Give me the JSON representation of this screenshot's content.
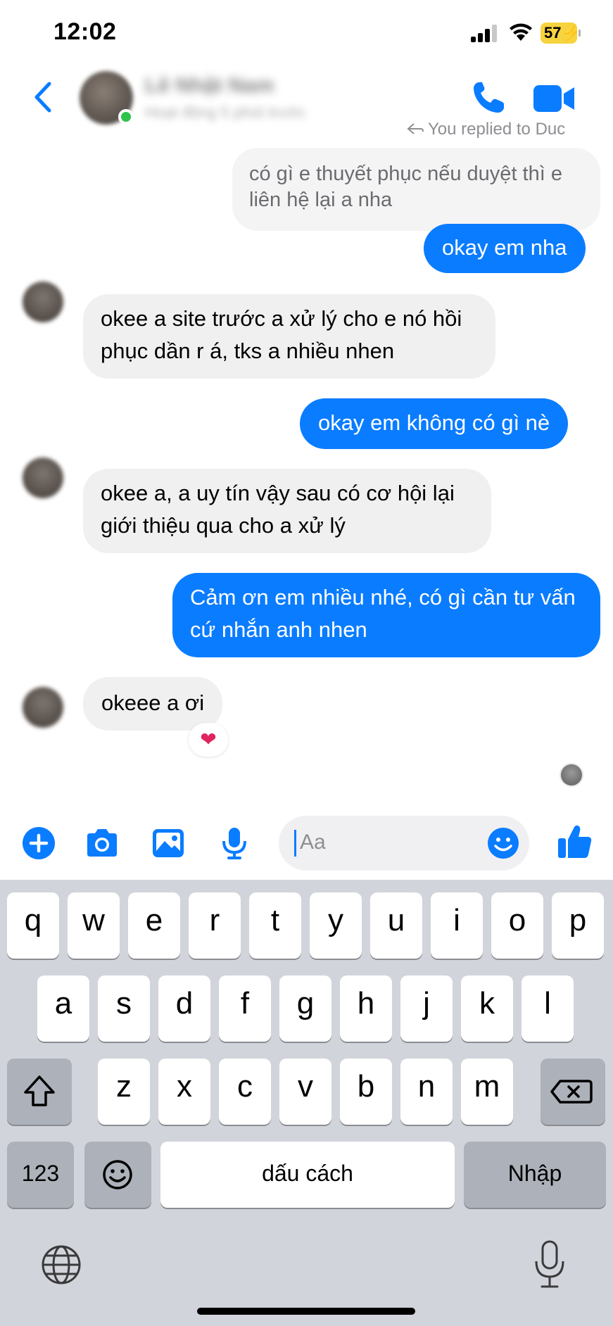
{
  "status_bar": {
    "time": "12:02",
    "battery": "57"
  },
  "header": {
    "name": "Lê Nhật Nam",
    "status": "Hoạt động 5 phút trước"
  },
  "chat": {
    "replied_note": "You replied to Duc",
    "messages": [
      {
        "direction": "outgoing_quote",
        "text": "có gì e thuyết phục nếu duyệt thì e liên hệ lại a nha"
      },
      {
        "direction": "outgoing",
        "text": "okay em nha"
      },
      {
        "direction": "incoming",
        "text": "okee a site trước a xử lý cho e nó hồi phục dần r á, tks a nhiều nhen"
      },
      {
        "direction": "outgoing",
        "text": "okay em không có gì nè"
      },
      {
        "direction": "incoming",
        "text": "okee a, a uy tín vậy sau có cơ hội lại giới thiệu qua cho a xử lý"
      },
      {
        "direction": "outgoing",
        "text": "Cảm ơn em nhiều nhé, có gì cần tư vấn cứ nhắn anh nhen"
      },
      {
        "direction": "incoming",
        "text": "okeee a ơi",
        "reaction": "❤"
      }
    ]
  },
  "composer": {
    "placeholder": "Aa"
  },
  "keyboard": {
    "row1": [
      "q",
      "w",
      "e",
      "r",
      "t",
      "y",
      "u",
      "i",
      "o",
      "p"
    ],
    "row2": [
      "a",
      "s",
      "d",
      "f",
      "g",
      "h",
      "j",
      "k",
      "l"
    ],
    "row3": [
      "z",
      "x",
      "c",
      "v",
      "b",
      "n",
      "m"
    ],
    "numbers_label": "123",
    "space_label": "dấu cách",
    "return_label": "Nhập"
  },
  "colors": {
    "accent": "#0a7cff",
    "incoming_bubble": "#f0f0f0",
    "keyboard_bg": "#d1d4da"
  }
}
